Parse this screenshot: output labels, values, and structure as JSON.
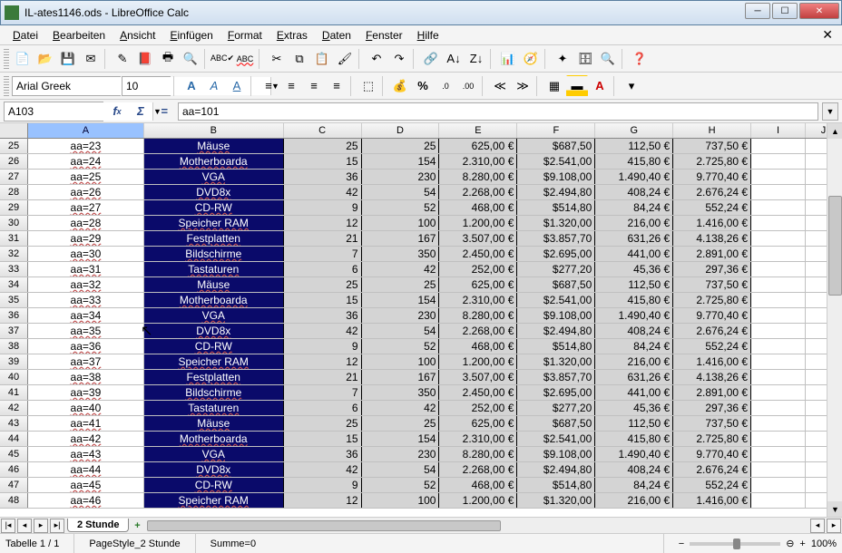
{
  "window": {
    "title": "IL-ates1146.ods - LibreOffice Calc"
  },
  "menus": [
    "Datei",
    "Bearbeiten",
    "Ansicht",
    "Einfügen",
    "Format",
    "Extras",
    "Daten",
    "Fenster",
    "Hilfe"
  ],
  "font": {
    "name": "Arial Greek",
    "size": "10"
  },
  "namebox": {
    "value": "A103"
  },
  "formula": {
    "value": "aa=101"
  },
  "columns": [
    "A",
    "B",
    "C",
    "D",
    "E",
    "F",
    "G",
    "H",
    "I",
    "J"
  ],
  "col_widths": {
    "A": 128,
    "B": 154,
    "C": 86,
    "D": 86,
    "E": 86,
    "F": 86,
    "G": 86,
    "H": 86,
    "I": 60,
    "J": 40
  },
  "selected_col": "A",
  "rows": [
    {
      "n": 25,
      "A": "aa=23",
      "B": "Mäuse",
      "C": "25",
      "D": "25",
      "E": "625,00 €",
      "F": "$687,50",
      "G": "112,50 €",
      "H": "737,50 €"
    },
    {
      "n": 26,
      "A": "aa=24",
      "B": "Motherboarda",
      "C": "15",
      "D": "154",
      "E": "2.310,00 €",
      "F": "$2.541,00",
      "G": "415,80 €",
      "H": "2.725,80 €"
    },
    {
      "n": 27,
      "A": "aa=25",
      "B": "VGA",
      "C": "36",
      "D": "230",
      "E": "8.280,00 €",
      "F": "$9.108,00",
      "G": "1.490,40 €",
      "H": "9.770,40 €"
    },
    {
      "n": 28,
      "A": "aa=26",
      "B": "DVD8x",
      "C": "42",
      "D": "54",
      "E": "2.268,00 €",
      "F": "$2.494,80",
      "G": "408,24 €",
      "H": "2.676,24 €"
    },
    {
      "n": 29,
      "A": "aa=27",
      "B": "CD-RW",
      "C": "9",
      "D": "52",
      "E": "468,00 €",
      "F": "$514,80",
      "G": "84,24 €",
      "H": "552,24 €"
    },
    {
      "n": 30,
      "A": "aa=28",
      "B": "Speicher RAM",
      "C": "12",
      "D": "100",
      "E": "1.200,00 €",
      "F": "$1.320,00",
      "G": "216,00 €",
      "H": "1.416,00 €"
    },
    {
      "n": 31,
      "A": "aa=29",
      "B": "Festplatten",
      "C": "21",
      "D": "167",
      "E": "3.507,00 €",
      "F": "$3.857,70",
      "G": "631,26 €",
      "H": "4.138,26 €"
    },
    {
      "n": 32,
      "A": "aa=30",
      "B": "Bildschirme",
      "C": "7",
      "D": "350",
      "E": "2.450,00 €",
      "F": "$2.695,00",
      "G": "441,00 €",
      "H": "2.891,00 €"
    },
    {
      "n": 33,
      "A": "aa=31",
      "B": "Tastaturen",
      "C": "6",
      "D": "42",
      "E": "252,00 €",
      "F": "$277,20",
      "G": "45,36 €",
      "H": "297,36 €"
    },
    {
      "n": 34,
      "A": "aa=32",
      "B": "Mäuse",
      "C": "25",
      "D": "25",
      "E": "625,00 €",
      "F": "$687,50",
      "G": "112,50 €",
      "H": "737,50 €"
    },
    {
      "n": 35,
      "A": "aa=33",
      "B": "Motherboarda",
      "C": "15",
      "D": "154",
      "E": "2.310,00 €",
      "F": "$2.541,00",
      "G": "415,80 €",
      "H": "2.725,80 €"
    },
    {
      "n": 36,
      "A": "aa=34",
      "B": "VGA",
      "C": "36",
      "D": "230",
      "E": "8.280,00 €",
      "F": "$9.108,00",
      "G": "1.490,40 €",
      "H": "9.770,40 €"
    },
    {
      "n": 37,
      "A": "aa=35",
      "B": "DVD8x",
      "C": "42",
      "D": "54",
      "E": "2.268,00 €",
      "F": "$2.494,80",
      "G": "408,24 €",
      "H": "2.676,24 €"
    },
    {
      "n": 38,
      "A": "aa=36",
      "B": "CD-RW",
      "C": "9",
      "D": "52",
      "E": "468,00 €",
      "F": "$514,80",
      "G": "84,24 €",
      "H": "552,24 €"
    },
    {
      "n": 39,
      "A": "aa=37",
      "B": "Speicher RAM",
      "C": "12",
      "D": "100",
      "E": "1.200,00 €",
      "F": "$1.320,00",
      "G": "216,00 €",
      "H": "1.416,00 €"
    },
    {
      "n": 40,
      "A": "aa=38",
      "B": "Festplatten",
      "C": "21",
      "D": "167",
      "E": "3.507,00 €",
      "F": "$3.857,70",
      "G": "631,26 €",
      "H": "4.138,26 €"
    },
    {
      "n": 41,
      "A": "aa=39",
      "B": "Bildschirme",
      "C": "7",
      "D": "350",
      "E": "2.450,00 €",
      "F": "$2.695,00",
      "G": "441,00 €",
      "H": "2.891,00 €"
    },
    {
      "n": 42,
      "A": "aa=40",
      "B": "Tastaturen",
      "C": "6",
      "D": "42",
      "E": "252,00 €",
      "F": "$277,20",
      "G": "45,36 €",
      "H": "297,36 €"
    },
    {
      "n": 43,
      "A": "aa=41",
      "B": "Mäuse",
      "C": "25",
      "D": "25",
      "E": "625,00 €",
      "F": "$687,50",
      "G": "112,50 €",
      "H": "737,50 €"
    },
    {
      "n": 44,
      "A": "aa=42",
      "B": "Motherboarda",
      "C": "15",
      "D": "154",
      "E": "2.310,00 €",
      "F": "$2.541,00",
      "G": "415,80 €",
      "H": "2.725,80 €"
    },
    {
      "n": 45,
      "A": "aa=43",
      "B": "VGA",
      "C": "36",
      "D": "230",
      "E": "8.280,00 €",
      "F": "$9.108,00",
      "G": "1.490,40 €",
      "H": "9.770,40 €"
    },
    {
      "n": 46,
      "A": "aa=44",
      "B": "DVD8x",
      "C": "42",
      "D": "54",
      "E": "2.268,00 €",
      "F": "$2.494,80",
      "G": "408,24 €",
      "H": "2.676,24 €"
    },
    {
      "n": 47,
      "A": "aa=45",
      "B": "CD-RW",
      "C": "9",
      "D": "52",
      "E": "468,00 €",
      "F": "$514,80",
      "G": "84,24 €",
      "H": "552,24 €"
    },
    {
      "n": 48,
      "A": "aa=46",
      "B": "Speicher RAM",
      "C": "12",
      "D": "100",
      "E": "1.200,00 €",
      "F": "$1.320,00",
      "G": "216,00 €",
      "H": "1.416,00 €"
    }
  ],
  "sheet": {
    "tab": "2 Stunde"
  },
  "status": {
    "sheet": "Tabelle 1 / 1",
    "style": "PageStyle_2 Stunde",
    "sum": "Summe=0",
    "zoom": "100%"
  },
  "zoom_symbols": {
    "minus": "−",
    "plus": "+",
    "circle": "⊖"
  }
}
